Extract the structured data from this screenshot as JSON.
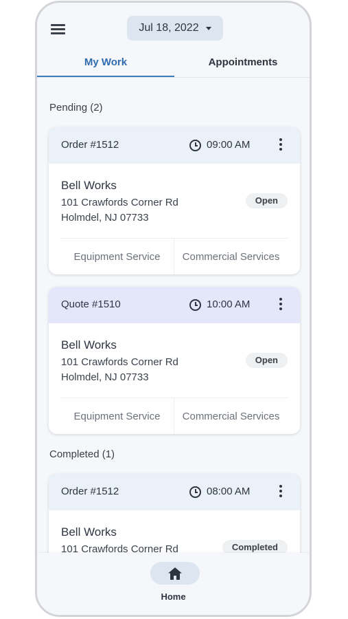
{
  "header": {
    "date": "Jul 18, 2022",
    "tabs": [
      {
        "label": "My Work",
        "active": true
      },
      {
        "label": "Appointments",
        "active": false
      }
    ]
  },
  "sections": {
    "pending": "Pending (2)",
    "completed": "Completed (1)"
  },
  "cards": [
    {
      "title": "Order #1512",
      "time": "09:00 AM",
      "kind": "order",
      "customer": "Bell Works",
      "address1": "101 Crawfords Corner Rd",
      "address2": "Holmdel, NJ 07733",
      "status": "Open",
      "footer_left": "Equipment Service",
      "footer_right": "Commercial Services"
    },
    {
      "title": "Quote #1510",
      "time": "10:00 AM",
      "kind": "quote",
      "customer": "Bell Works",
      "address1": "101 Crawfords Corner Rd",
      "address2": "Holmdel, NJ 07733",
      "status": "Open",
      "footer_left": "Equipment Service",
      "footer_right": "Commercial Services"
    },
    {
      "title": "Order #1512",
      "time": "08:00 AM",
      "kind": "order",
      "customer": "Bell Works",
      "address1": "101 Crawfords Corner Rd",
      "status": "Completed"
    }
  ],
  "bottom_nav": {
    "home_label": "Home"
  },
  "icons": [
    "menu-icon",
    "caret-down-icon",
    "clock-icon",
    "more-vertical-icon",
    "home-icon"
  ],
  "colors": {
    "accent": "#3a7bc4",
    "order_header": "#eaf1f8",
    "quote_header": "#e4e6fa"
  }
}
